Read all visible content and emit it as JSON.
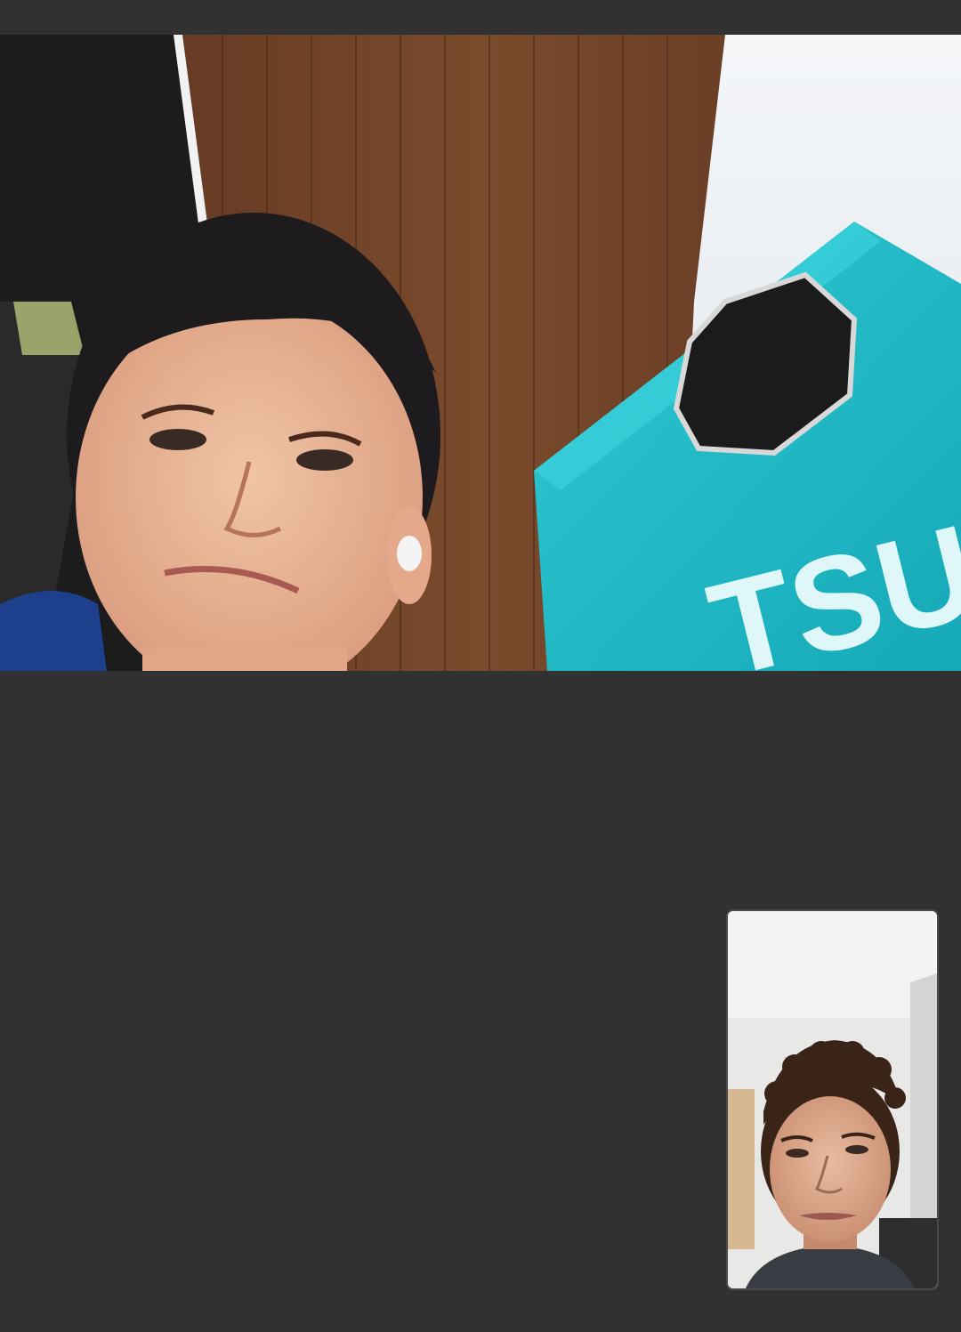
{
  "call": {
    "remote_participant": {
      "video_feed": "remote-camera-feed",
      "background_text": "TSU"
    },
    "self_preview": {
      "video_feed": "self-camera-feed"
    }
  },
  "colors": {
    "background": "#313131",
    "remote_accent": "#1fb8c4",
    "wood": "#6b3f25",
    "self_view_border": "#4a4a4a"
  }
}
